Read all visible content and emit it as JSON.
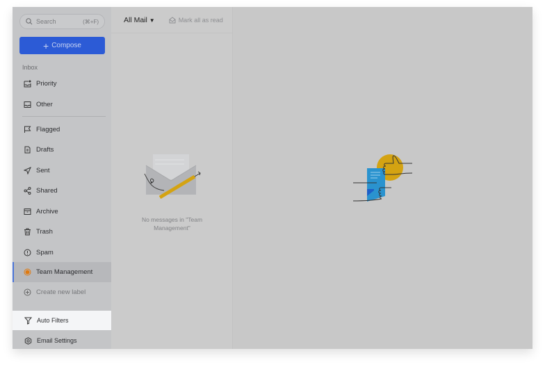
{
  "search": {
    "placeholder": "Search",
    "shortcut": "(⌘+F)"
  },
  "compose": {
    "label": "Compose"
  },
  "sidebar": {
    "section": "Inbox",
    "items": [
      {
        "label": "Priority",
        "icon": "inbox-star-icon"
      },
      {
        "label": "Other",
        "icon": "inbox-icon"
      },
      {
        "label": "Flagged",
        "icon": "flag-icon"
      },
      {
        "label": "Drafts",
        "icon": "draft-icon"
      },
      {
        "label": "Sent",
        "icon": "send-icon"
      },
      {
        "label": "Shared",
        "icon": "share-icon"
      },
      {
        "label": "Archive",
        "icon": "archive-icon"
      },
      {
        "label": "Trash",
        "icon": "trash-icon"
      },
      {
        "label": "Spam",
        "icon": "spam-icon"
      },
      {
        "label": "Team Management",
        "icon": "label-dot-icon",
        "active": true
      },
      {
        "label": "Create new label",
        "icon": "plus-circle-icon"
      }
    ],
    "auto_filters": "Auto Filters",
    "email_settings": "Email Settings"
  },
  "list": {
    "folder": "All Mail",
    "mark_all": "Mark all as read",
    "empty": "No messages in \"Team Management\""
  },
  "colors": {
    "accent": "#2c5bd6",
    "label": "#e07a10",
    "illustration_yellow": "#d4a312",
    "illustration_blue": "#2a93cf"
  }
}
